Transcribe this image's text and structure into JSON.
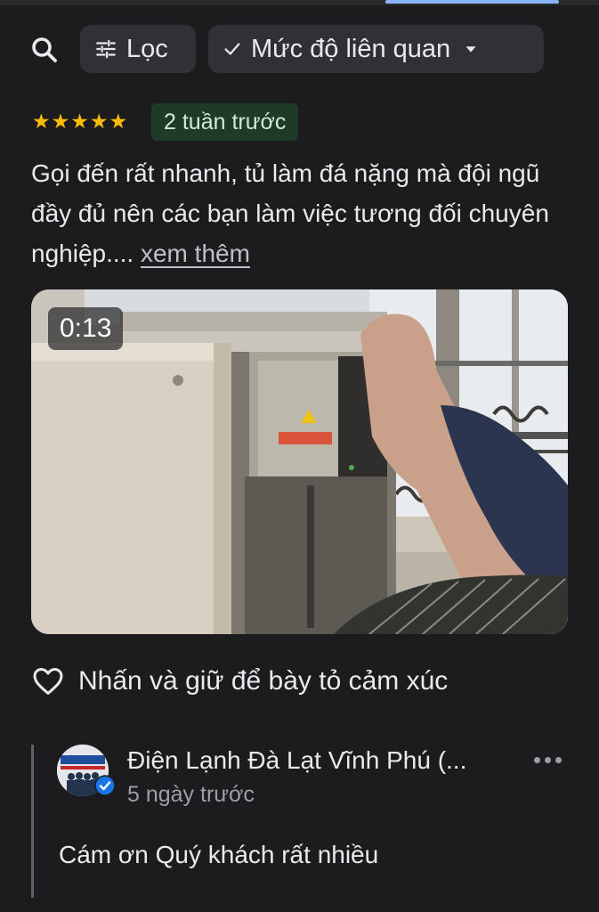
{
  "filters": {
    "search_icon": "search-icon",
    "filter_label": "Lọc",
    "filter_icon": "tune-icon",
    "sort_label": "Mức độ liên quan",
    "sort_icons": [
      "check-icon",
      "caret-down-icon"
    ]
  },
  "review": {
    "stars": [
      "★",
      "★",
      "★",
      "★",
      "★"
    ],
    "rating": 5,
    "date": "2 tuần trước",
    "text": "Gọi đến rất nhanh, tủ làm đá nặng mà đội ngũ đầy đủ nên các bạn làm việc tương đối chuyên nghiệp....",
    "more": "xem thêm",
    "video_duration": "0:13",
    "reaction_label": "Nhấn và giữ để bày tỏ cảm xúc"
  },
  "reply": {
    "owner_name": "Điện Lạnh Đà Lạt Vĩnh Phú (...",
    "date": "5 ngày trước",
    "text": "Cám ơn Quý khách rất nhiều"
  },
  "colors": {
    "background": "#1c1c1e",
    "chip": "#303134",
    "star": "#fbbc04",
    "date_badge": "#1e3a29",
    "accent": "#8ab4f8"
  }
}
